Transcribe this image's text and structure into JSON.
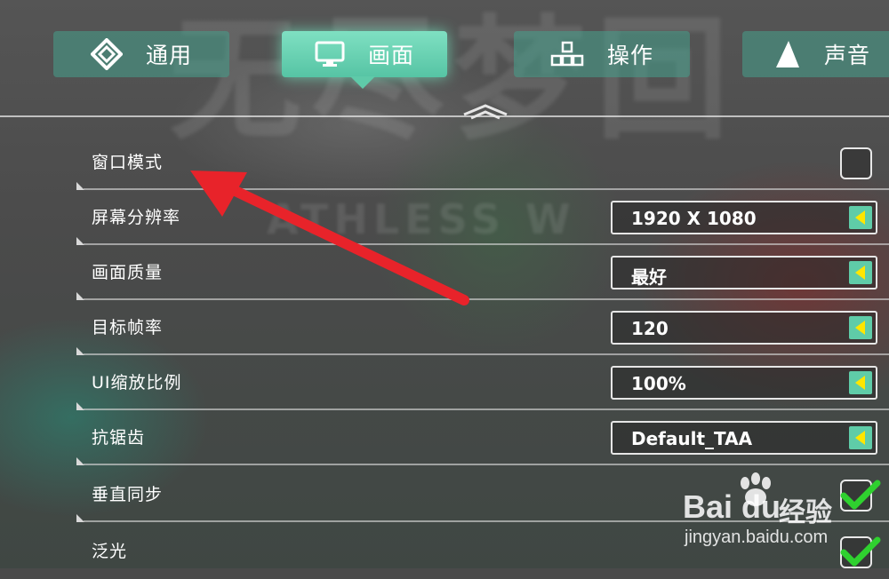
{
  "tabs": [
    {
      "label": "通用",
      "icon": "diamond-frame-icon",
      "active": false
    },
    {
      "label": "画面",
      "icon": "monitor-icon",
      "active": true
    },
    {
      "label": "操作",
      "icon": "blocks-icon",
      "active": false
    },
    {
      "label": "声音",
      "icon": "sound-cone-icon",
      "active": false
    }
  ],
  "background": {
    "title_text": "无尽梦回",
    "subtitle_text": "ATHLESS W"
  },
  "settings": [
    {
      "label": "窗口模式",
      "control": "checkbox",
      "checked": false
    },
    {
      "label": "屏幕分辨率",
      "control": "dropdown",
      "value": "1920 X 1080"
    },
    {
      "label": "画面质量",
      "control": "dropdown",
      "value": "最好"
    },
    {
      "label": "目标帧率",
      "control": "dropdown",
      "value": "120"
    },
    {
      "label": "UI缩放比例",
      "control": "dropdown",
      "value": "100%"
    },
    {
      "label": "抗锯齿",
      "control": "dropdown",
      "value": "Default_TAA"
    },
    {
      "label": "垂直同步",
      "control": "checkbox",
      "checked": true
    },
    {
      "label": "泛光",
      "control": "checkbox",
      "checked": true
    }
  ],
  "colors": {
    "accent": "#5fcca8",
    "tab_inactive": "#46a08c",
    "annotation_red": "#e8232a",
    "dropdown_arrow": "#ffe600",
    "checkmark": "#2fd12f"
  },
  "watermark": {
    "brand": "Bai du",
    "product": "经验",
    "url": "jingyan.baidu.com"
  }
}
